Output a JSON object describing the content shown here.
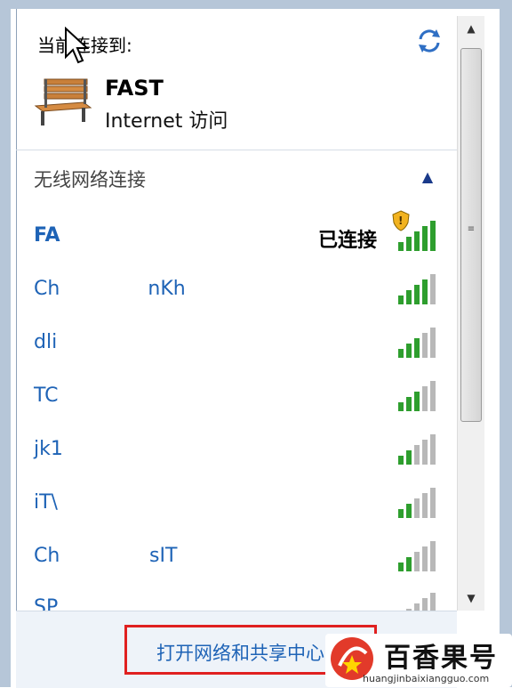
{
  "header": {
    "connected_label": "当前连接到:",
    "network_name": "FAST",
    "network_access": "Internet 访问"
  },
  "wireless": {
    "section_label": "无线网络连接",
    "collapse_icon": "chevron-up-icon",
    "networks": [
      {
        "ssid": "FA",
        "ssid_tail": "",
        "status": "已连接",
        "signal_bars": 5
      },
      {
        "ssid": "Ch",
        "ssid_tail": " nKh",
        "status": "",
        "signal_bars": 4
      },
      {
        "ssid": "dli",
        "ssid_tail": "",
        "status": "",
        "signal_bars": 3
      },
      {
        "ssid": "TC",
        "ssid_tail": "",
        "status": "",
        "signal_bars": 3
      },
      {
        "ssid": "jk1",
        "ssid_tail": "",
        "status": "",
        "signal_bars": 2
      },
      {
        "ssid": "iT\\",
        "ssid_tail": "",
        "status": "",
        "signal_bars": 2
      },
      {
        "ssid": "Ch",
        "ssid_tail": "sIT",
        "status": "",
        "signal_bars": 2
      },
      {
        "ssid": "SP",
        "ssid_tail": "",
        "status": "",
        "signal_bars": 1
      }
    ]
  },
  "footer": {
    "open_center_label": "打开网络和共享中心"
  },
  "watermark": {
    "text": "百香果号",
    "sub": "huangjinbaixiangguo.com"
  },
  "colors": {
    "link": "#1e63b6",
    "signal_green": "#2e9e2e",
    "signal_grey": "#b8b8b8",
    "highlight_border": "#e02020"
  }
}
